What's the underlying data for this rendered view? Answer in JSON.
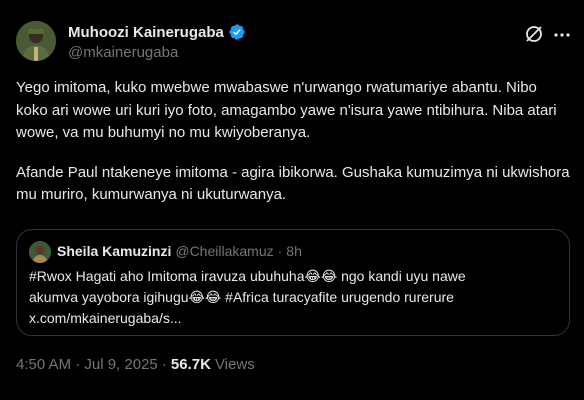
{
  "author": {
    "display_name": "Muhoozi Kainerugaba",
    "handle": "@mkainerugaba",
    "verified_color": "#1d9bf0"
  },
  "toolbar": {
    "grok_icon": "grok-icon",
    "more_icon": "more-icon"
  },
  "tweet": {
    "paragraph_1": "Yego imitoma, kuko mwebwe mwabaswe n'urwango rwatumariye abantu. Nibo koko ari wowe uri kuri iyo foto, amagambo yawe n'isura yawe ntibihura. Niba atari wowe, va mu buhumyi no mu kwiyoberanya.",
    "paragraph_2": "Afande Paul ntakeneye imitoma - agira ibikorwa. Gushaka kumuzimya ni ukwishora mu muriro, kumurwanya ni ukuturwanya."
  },
  "quote": {
    "name": "Sheila Kamuzinzi",
    "handle": "@Cheillakamuz",
    "dot": "·",
    "time": "8h",
    "line_1a": "#Rwox Hagati aho Imitoma iravuza ubuhuha",
    "line_1_emoji": "😂😂",
    "line_1b": " ngo kandi uyu nawe",
    "line_2a": "akumva yayobora igihugu",
    "line_2_emoji": "😂😂",
    "line_2b": " #Africa turacyafite urugendo rurerure",
    "line_3": "x.com/mkainerugaba/s..."
  },
  "meta": {
    "time": "4:50 AM · Jul 9, 2025 ·",
    "views_count": "56.7K",
    "views_label": "Views"
  }
}
